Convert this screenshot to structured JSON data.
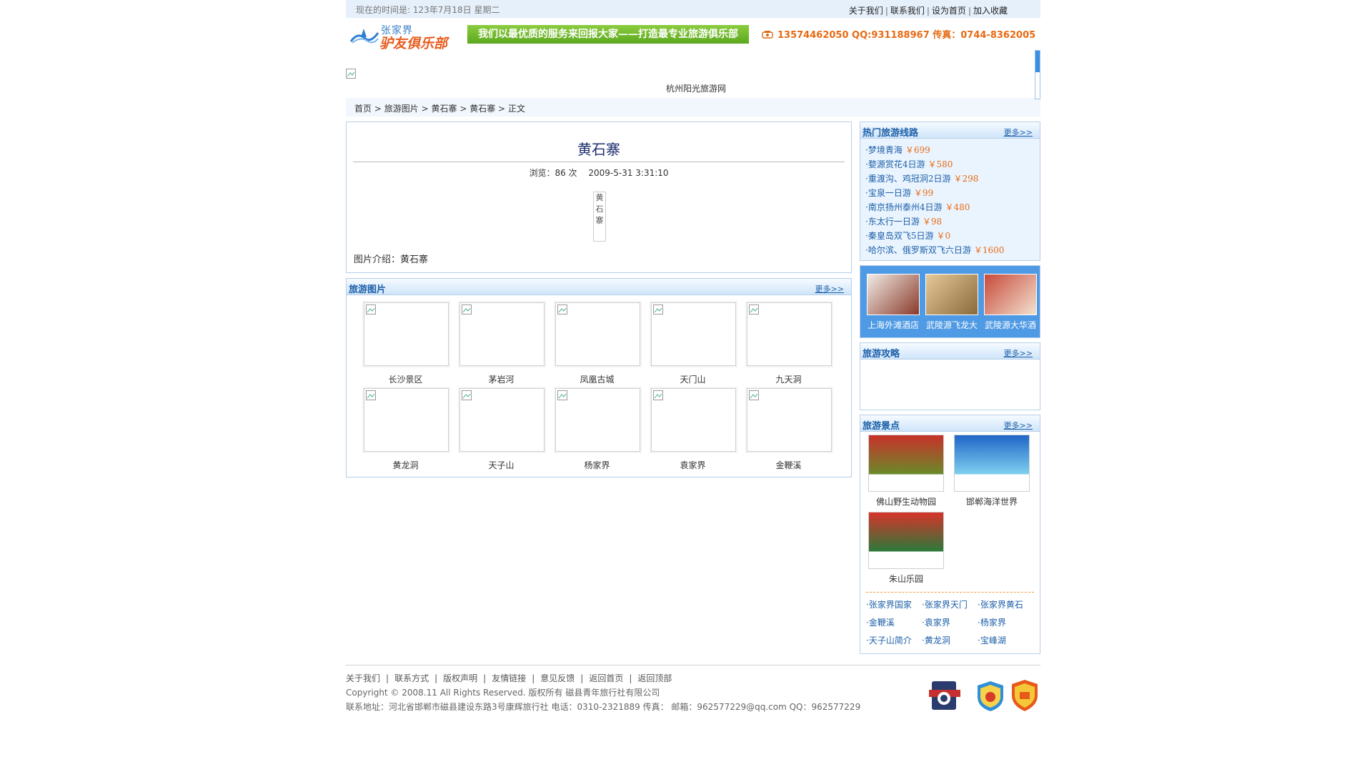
{
  "topbar": {
    "time": "现在的时间是: 123年7月18日 星期二",
    "links": [
      "关于我们",
      "联系我们",
      "设为首页",
      "加入收藏"
    ]
  },
  "header": {
    "logo_line1": "张家界",
    "logo_line2": "驴友俱乐部",
    "slogan": "我们以最优质的服务来回报大家——打造最专业旅游俱乐部",
    "contact": "13574462050  QQ:931188967 传真：0744-8362005"
  },
  "banner": {
    "site_name": "杭州阳光旅游网"
  },
  "breadcrumb": [
    "首页",
    ">",
    "旅游图片",
    ">",
    "黄石寨",
    ">",
    "黄石寨",
    ">",
    "正文"
  ],
  "article": {
    "title": "黄石寨",
    "views_label": "浏览：86 次",
    "date": "2009-5-31 3:31:10",
    "photo_alt": "黄石寨",
    "intro": "图片介绍：黄石寨"
  },
  "gallery": {
    "title": "旅游图片",
    "more": "更多>>",
    "items": [
      "长沙景区",
      "茅岩河",
      "凤凰古城",
      "天门山",
      "九天洞",
      "黄龙洞",
      "天子山",
      "杨家界",
      "袁家界",
      "金鞭溪"
    ]
  },
  "hot_routes": {
    "title": "热门旅游线路",
    "more": "更多>>",
    "items": [
      {
        "name": "·梦境青海",
        "price": "￥699"
      },
      {
        "name": "·婺源赏花4日游",
        "price": "￥580"
      },
      {
        "name": "·重渡沟、鸡冠洞2日游",
        "price": "￥298"
      },
      {
        "name": "·宝泉一日游",
        "price": "￥99"
      },
      {
        "name": "·南京扬州泰州4日游",
        "price": "￥480"
      },
      {
        "name": "·东太行一日游",
        "price": "￥98"
      },
      {
        "name": "·秦皇岛双飞5日游",
        "price": "￥0"
      },
      {
        "name": "·哈尔滨、俄罗斯双飞六日游",
        "price": "￥1600"
      }
    ]
  },
  "hotels": [
    "上海外滩酒店",
    "武陵源飞龙大",
    "武陵源大华酒"
  ],
  "guide": {
    "title": "旅游攻略",
    "more": "更多>>"
  },
  "spots": {
    "title": "旅游景点",
    "more": "更多>>",
    "items": [
      "佛山野生动物园",
      "邯郸海洋世界",
      "朱山乐园"
    ],
    "links": [
      "·张家界国家",
      "·张家界天门",
      "·张家界黄石",
      "·金鞭溪",
      "·袁家界",
      "·杨家界",
      "·天子山简介",
      "·黄龙洞",
      "·宝峰湖"
    ]
  },
  "footer": {
    "nav": [
      "关于我们",
      "联系方式",
      "版权声明",
      "友情链接",
      "意见反馈",
      "返回首页",
      "返回顶部"
    ],
    "copyright": "Copyright © 2008.11   All Rights Reserved.  版权所有  磁县青年旅行社有限公司",
    "address": "联系地址：河北省邯郸市磁县建设东路3号康辉旅行社  电话：0310-2321889  传真：   邮箱：962577229@qq.com  QQ：962577229"
  }
}
